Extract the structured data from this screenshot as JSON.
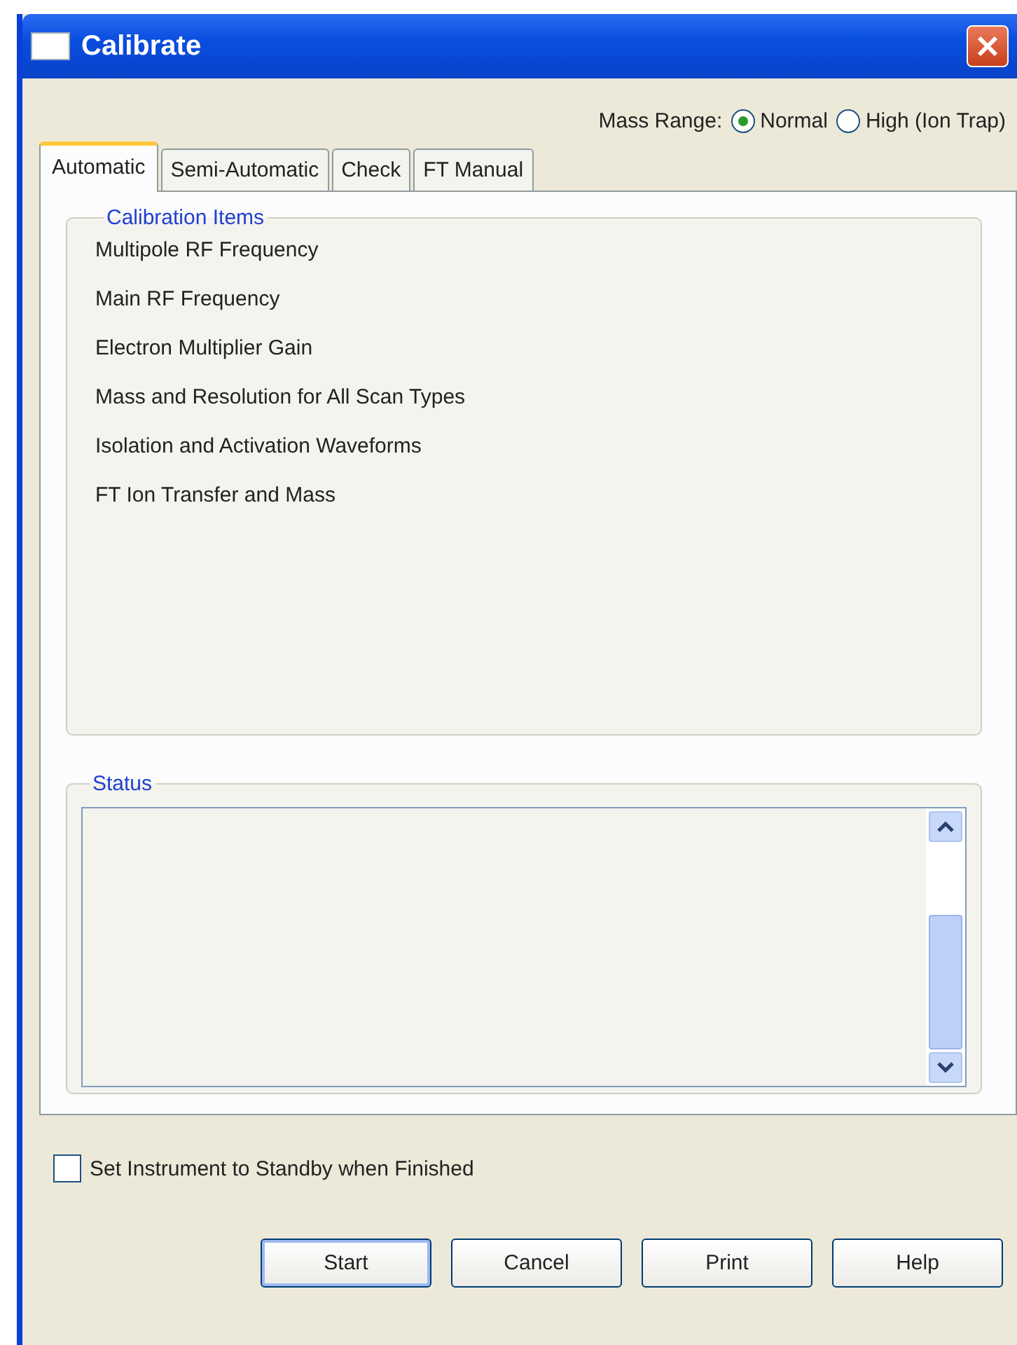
{
  "window": {
    "title": "Calibrate"
  },
  "mass_range": {
    "label": "Mass Range:",
    "options": [
      {
        "label": "Normal",
        "selected": true
      },
      {
        "label": "High (Ion Trap)",
        "selected": false
      }
    ]
  },
  "tabs": [
    {
      "label": "Automatic",
      "selected": true
    },
    {
      "label": "Semi-Automatic",
      "selected": false
    },
    {
      "label": "Check",
      "selected": false
    },
    {
      "label": "FT Manual",
      "selected": false
    }
  ],
  "calibration_items": {
    "title": "Calibration Items",
    "items": [
      "Multipole RF Frequency",
      "Main RF Frequency",
      "Electron Multiplier Gain",
      "Mass and Resolution for All Scan Types",
      "Isolation and Activation Waveforms",
      "FT Ion Transfer and Mass"
    ]
  },
  "status": {
    "title": "Status"
  },
  "standby": {
    "label": "Set Instrument to Standby when Finished",
    "checked": false
  },
  "buttons": [
    {
      "label": "Start",
      "default": true
    },
    {
      "label": "Cancel",
      "default": false
    },
    {
      "label": "Print",
      "default": false
    },
    {
      "label": "Help",
      "default": false
    }
  ]
}
